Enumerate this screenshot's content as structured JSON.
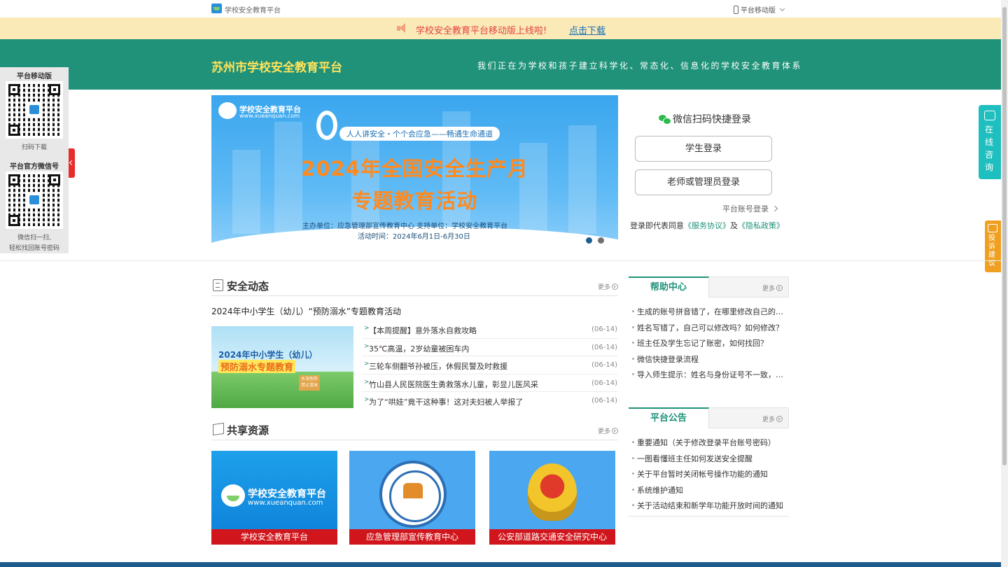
{
  "topbar": {
    "brand": "学校安全教育平台",
    "mobile_label": "平台移动版"
  },
  "notice": {
    "text": "学校安全教育平台移动版上线啦!",
    "link": "点击下载"
  },
  "header": {
    "title": "苏州市学校安全教育平台",
    "slogan": "我们正在为学校和孩子建立科学化、常态化、信息化的学校安全教育体系"
  },
  "banner": {
    "logo_name": "学校安全教育平台",
    "logo_url": "www.xueanquan.com",
    "tagline": "人人讲安全・个个会应急——畅通生命通道",
    "headline1": "2024年全国安全生产月",
    "headline2": "专题教育活动",
    "organizers": "主办单位：应急管理部宣传教育中心    支持单位：学校安全教育平台",
    "date": "活动时间：2024年6月1日-6月30日",
    "slides": 2,
    "active_slide": 1
  },
  "login": {
    "wechat_label": "微信扫码快捷登录",
    "student_button": "学生登录",
    "teacher_button": "老师或管理员登录",
    "account_login": "平台账号登录",
    "agree_prefix": "登录即代表同意",
    "service_agreement": "《服务协议》",
    "and": "及",
    "privacy_policy": "《隐私政策》"
  },
  "left_float": {
    "mobile_title": "平台移动版",
    "mobile_caption": "扫码下载",
    "wechat_title": "平台官方微信号",
    "wechat_caption_1": "微信扫一扫,",
    "wechat_caption_2": "轻松找回账号密码"
  },
  "right_float": {
    "consult": "在线咨询",
    "suggest": "投诉建议"
  },
  "news": {
    "title": "安全动态",
    "more": "更多",
    "headline": "2024年中小学生（幼儿）“预防溺水”专题教育活动",
    "image_line1": "2024年中小学生（幼儿）",
    "image_line2": "预防溺水专题教育",
    "image_sign": "水深危险 禁止游泳",
    "items": [
      {
        "title": "【本周提醒】意外落水自救攻略",
        "date": "(06-14)"
      },
      {
        "title": "35℃高温，2岁幼童被困车内",
        "date": "(06-14)"
      },
      {
        "title": "三轮车侧翻爷孙被压，休假民警及时救援",
        "date": "(06-14)"
      },
      {
        "title": "竹山县人民医院医生勇救落水儿童，彰显儿医风采",
        "date": "(06-14)"
      },
      {
        "title": "为了“哄娃”竟干这种事！这对夫妇被人举报了",
        "date": "(06-14)"
      }
    ]
  },
  "resources": {
    "title": "共享资源",
    "more": "更多",
    "items": [
      {
        "caption": "学校安全教育平台",
        "logo_name": "学校安全教育平台",
        "logo_url": "www.xueanquan.com"
      },
      {
        "caption": "应急管理部宣传教育中心"
      },
      {
        "caption": "公安部道路交通安全研究中心"
      }
    ]
  },
  "help": {
    "title": "帮助中心",
    "more": "更多",
    "items": [
      "生成的账号拼音错了，在哪里修改自己的账号？",
      "姓名写错了，自己可以修改吗？如何修改？",
      "班主任及学生忘记了账密，如何找回？",
      "微信快捷登录流程",
      "导入师生提示：姓名与身份证号不一致，如何处理？"
    ]
  },
  "announce": {
    "title": "平台公告",
    "more": "更多",
    "items": [
      "重要通知（关于修改登录平台账号密码）",
      "一图看懂班主任如何发送安全提醒",
      "关于平台暂时关闭帐号操作功能的通知",
      "系统维护通知",
      "关于活动结束和新学年功能开放时间的通知"
    ]
  },
  "colors": {
    "brand_green": "#1f9279",
    "title_yellow": "#ffe35c",
    "notice_bg": "#f9eab8",
    "notice_red": "#e54040",
    "resource_caption_red": "#d0161c"
  }
}
